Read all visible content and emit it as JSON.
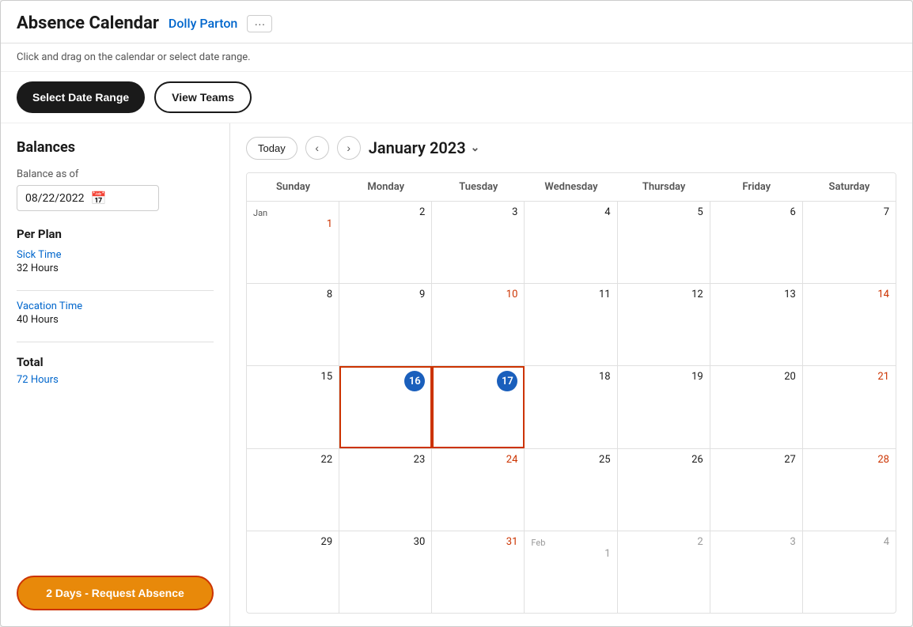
{
  "header": {
    "title": "Absence Calendar",
    "user_name": "Dolly Parton",
    "more_icon": "···"
  },
  "subtitle": "Click and drag on the calendar or select date range.",
  "toolbar": {
    "select_date_range": "Select Date Range",
    "view_teams": "View Teams"
  },
  "sidebar": {
    "balances_title": "Balances",
    "balance_as_of_label": "Balance as of",
    "balance_date": "08/22/2022",
    "per_plan_title": "Per Plan",
    "plans": [
      {
        "name": "Sick Time",
        "hours": "32 Hours"
      },
      {
        "name": "Vacation Time",
        "hours": "40 Hours"
      }
    ],
    "total_title": "Total",
    "total_hours": "72 Hours",
    "request_absence_btn": "2 Days - Request Absence"
  },
  "calendar": {
    "today_btn": "Today",
    "month_title": "January 2023",
    "headers": [
      "Sunday",
      "Monday",
      "Tuesday",
      "Wednesday",
      "Thursday",
      "Friday",
      "Saturday"
    ],
    "rows": [
      [
        {
          "num": "Jan",
          "day": "1",
          "label": true,
          "weekend": false,
          "selected": false,
          "other": false
        },
        {
          "num": "2",
          "label": false,
          "weekend": false,
          "selected": false,
          "other": false
        },
        {
          "num": "3",
          "label": false,
          "weekend": false,
          "selected": false,
          "other": false
        },
        {
          "num": "4",
          "label": false,
          "weekend": false,
          "selected": false,
          "other": false
        },
        {
          "num": "5",
          "label": false,
          "weekend": false,
          "selected": false,
          "other": false
        },
        {
          "num": "6",
          "label": false,
          "weekend": false,
          "selected": false,
          "other": false
        },
        {
          "num": "7",
          "label": false,
          "weekend": false,
          "selected": false,
          "other": false
        }
      ],
      [
        {
          "num": "8",
          "label": false,
          "weekend": false,
          "selected": false,
          "other": false
        },
        {
          "num": "9",
          "label": false,
          "weekend": false,
          "selected": false,
          "other": false
        },
        {
          "num": "10",
          "label": false,
          "weekend": true,
          "selected": false,
          "other": false
        },
        {
          "num": "11",
          "label": false,
          "weekend": false,
          "selected": false,
          "other": false
        },
        {
          "num": "12",
          "label": false,
          "weekend": false,
          "selected": false,
          "other": false
        },
        {
          "num": "13",
          "label": false,
          "weekend": false,
          "selected": false,
          "other": false
        },
        {
          "num": "14",
          "label": false,
          "weekend": true,
          "selected": false,
          "other": false
        }
      ],
      [
        {
          "num": "15",
          "label": false,
          "weekend": false,
          "selected": false,
          "other": false
        },
        {
          "num": "16",
          "label": false,
          "weekend": false,
          "selected": true,
          "other": false
        },
        {
          "num": "17",
          "label": false,
          "weekend": true,
          "selected": true,
          "other": false
        },
        {
          "num": "18",
          "label": false,
          "weekend": false,
          "selected": false,
          "other": false
        },
        {
          "num": "19",
          "label": false,
          "weekend": false,
          "selected": false,
          "other": false
        },
        {
          "num": "20",
          "label": false,
          "weekend": false,
          "selected": false,
          "other": false
        },
        {
          "num": "21",
          "label": false,
          "weekend": true,
          "selected": false,
          "other": false
        }
      ],
      [
        {
          "num": "22",
          "label": false,
          "weekend": false,
          "selected": false,
          "other": false
        },
        {
          "num": "23",
          "label": false,
          "weekend": false,
          "selected": false,
          "other": false
        },
        {
          "num": "24",
          "label": false,
          "weekend": true,
          "selected": false,
          "other": false
        },
        {
          "num": "25",
          "label": false,
          "weekend": false,
          "selected": false,
          "other": false
        },
        {
          "num": "26",
          "label": false,
          "weekend": false,
          "selected": false,
          "other": false
        },
        {
          "num": "27",
          "label": false,
          "weekend": false,
          "selected": false,
          "other": false
        },
        {
          "num": "28",
          "label": false,
          "weekend": true,
          "selected": false,
          "other": false
        }
      ],
      [
        {
          "num": "29",
          "label": false,
          "weekend": false,
          "selected": false,
          "other": false
        },
        {
          "num": "30",
          "label": false,
          "weekend": false,
          "selected": false,
          "other": false
        },
        {
          "num": "31",
          "label": false,
          "weekend": true,
          "selected": false,
          "other": false
        },
        {
          "num": "Feb 1",
          "label": false,
          "weekend": false,
          "selected": false,
          "other": true
        },
        {
          "num": "2",
          "label": false,
          "weekend": false,
          "selected": false,
          "other": true
        },
        {
          "num": "3",
          "label": false,
          "weekend": false,
          "selected": false,
          "other": true
        },
        {
          "num": "4",
          "label": false,
          "weekend": true,
          "selected": false,
          "other": true
        }
      ]
    ]
  }
}
